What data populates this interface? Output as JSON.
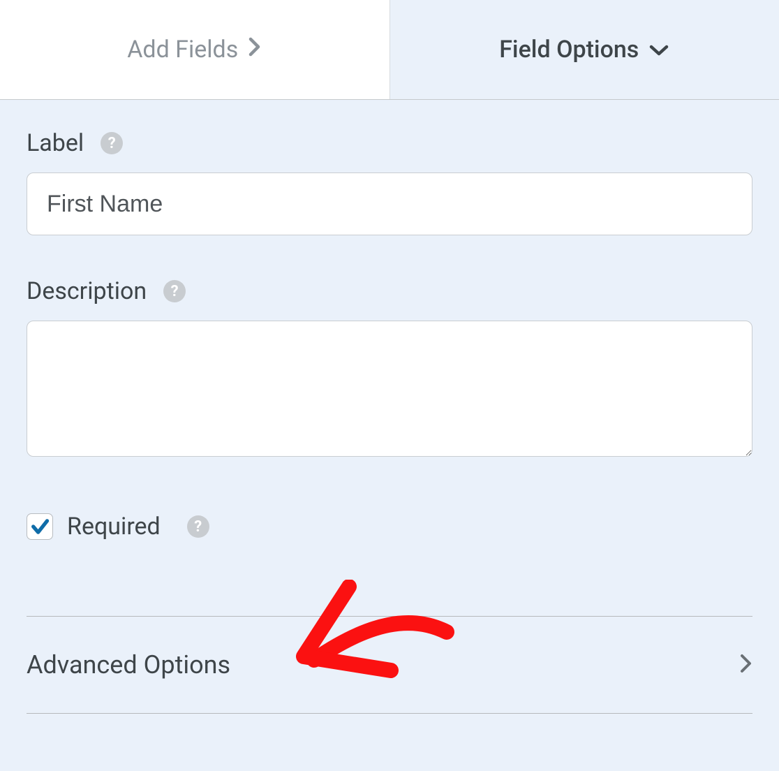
{
  "tabs": {
    "add_fields": "Add Fields",
    "field_options": "Field Options"
  },
  "fields": {
    "label_heading": "Label",
    "label_value": "First Name",
    "description_heading": "Description",
    "description_value": "",
    "required_label": "Required",
    "required_checked": true
  },
  "advanced": {
    "title": "Advanced Options"
  },
  "colors": {
    "check": "#0f6ca8",
    "annotation": "#fb1111"
  }
}
